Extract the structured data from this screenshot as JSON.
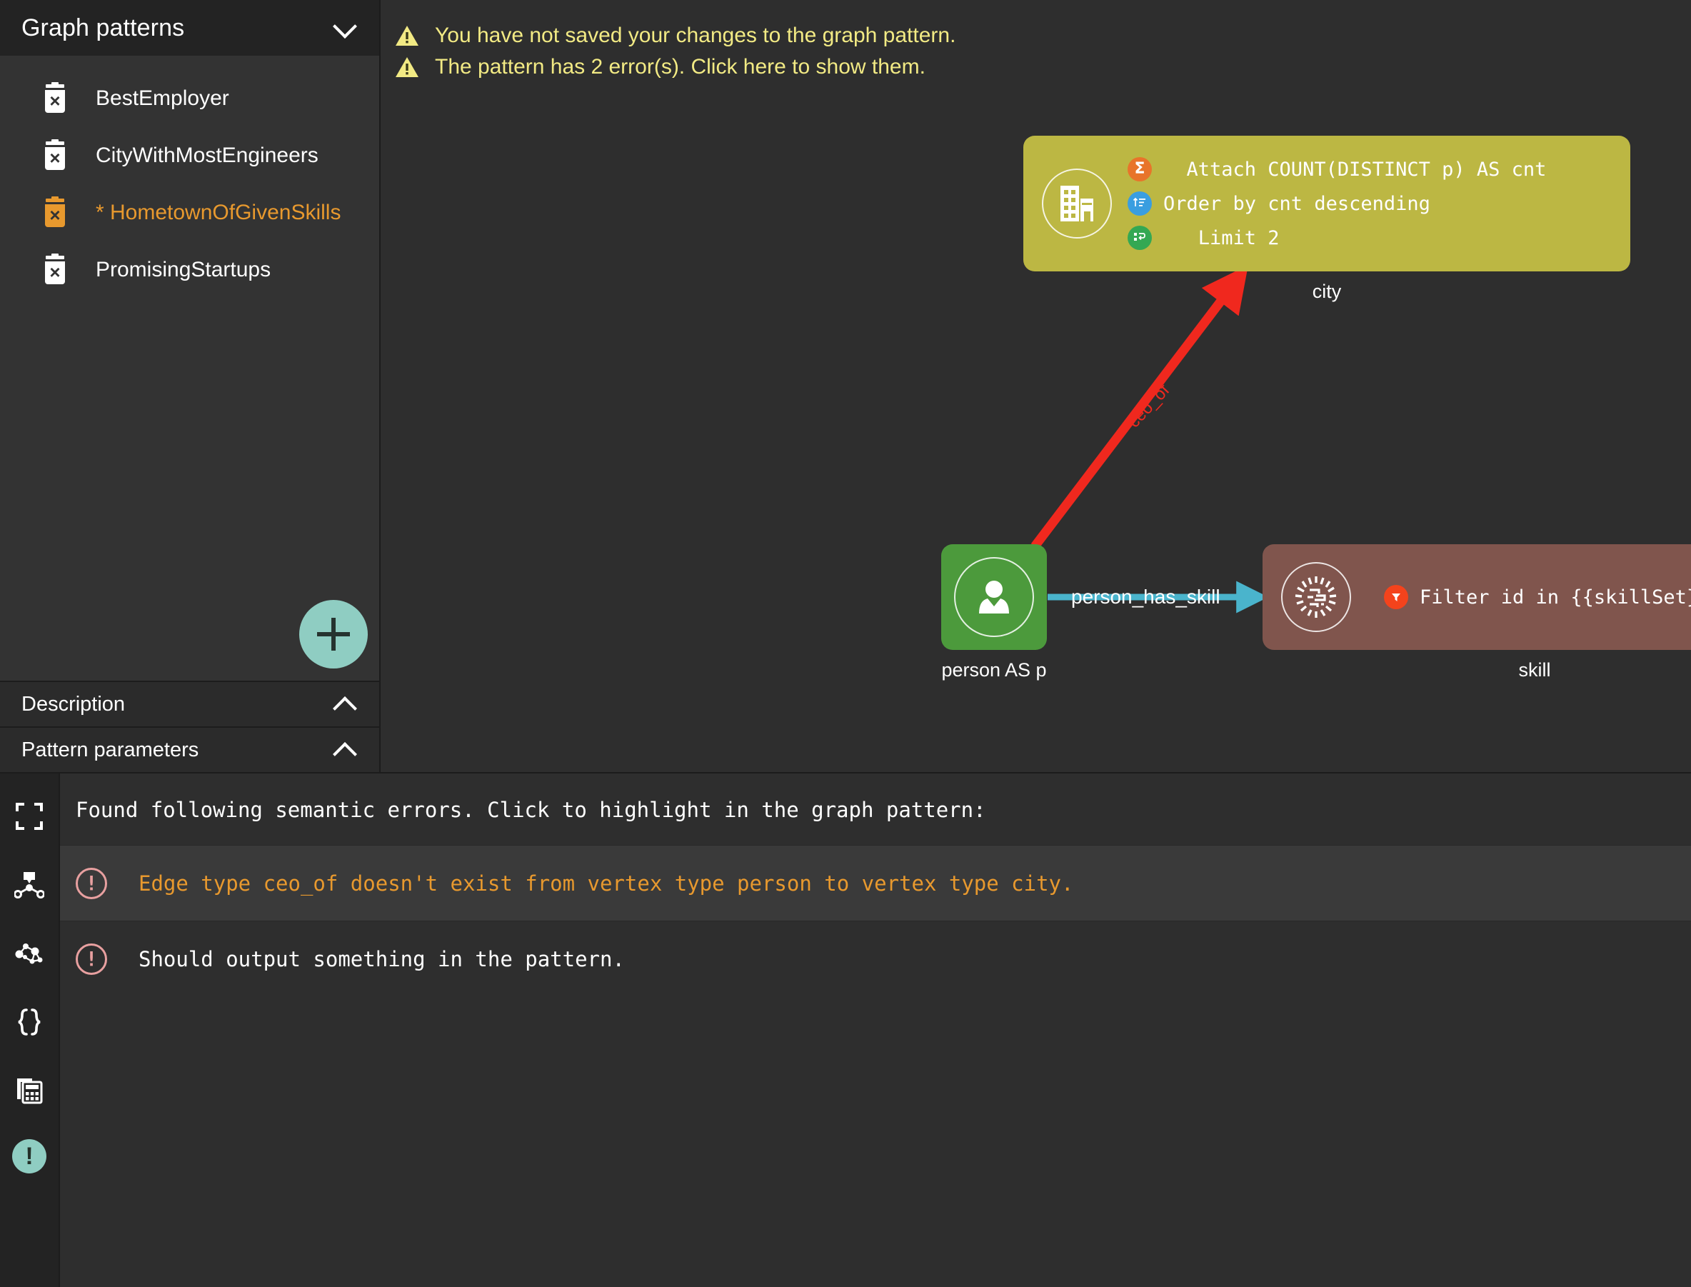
{
  "sidebar": {
    "header_title": "Graph patterns",
    "collapse_icon": "chevron-down-icon",
    "patterns": [
      {
        "label": "BestEmployer",
        "active": false,
        "delete_icon": "trash-delete-icon"
      },
      {
        "label": "CityWithMostEngineers",
        "active": false,
        "delete_icon": "trash-delete-icon"
      },
      {
        "label": "* HometownOfGivenSkills",
        "active": true,
        "delete_icon": "trash-delete-icon"
      },
      {
        "label": "PromisingStartups",
        "active": false,
        "delete_icon": "trash-delete-icon"
      }
    ],
    "add_button_icon": "plus-icon",
    "sections": [
      {
        "label": "Description",
        "icon": "chevron-up-icon"
      },
      {
        "label": "Pattern parameters",
        "icon": "chevron-up-icon"
      }
    ],
    "active_color": "#e8992e"
  },
  "canvas": {
    "warnings": [
      {
        "icon": "warning-triangle-icon",
        "text": "You have not saved your changes to the graph pattern."
      },
      {
        "icon": "warning-triangle-icon",
        "text": "The pattern has 2 error(s). Click here to show them."
      }
    ],
    "warning_color": "#f2ea84",
    "nodes": [
      {
        "id": "city",
        "label": "city",
        "icon": "building-city-icon",
        "color": "#bcb743",
        "statements": [
          {
            "badge": "sum-aggregate-icon",
            "badge_symbol": "Σ",
            "text": "  Attach COUNT(DISTINCT p) AS cnt"
          },
          {
            "badge": "order-by-icon",
            "badge_symbol": "",
            "text": "Order by cnt descending"
          },
          {
            "badge": "limit-icon",
            "badge_symbol": "",
            "text": "   Limit 2"
          }
        ]
      },
      {
        "id": "person",
        "label": "person AS p",
        "icon": "person-avatar-icon",
        "color": "#4c9a3c",
        "statements": []
      },
      {
        "id": "skill",
        "label": "skill",
        "icon": "chip-skill-icon",
        "color": "#80554d",
        "statements": [
          {
            "badge": "filter-funnel-icon",
            "badge_symbol": "",
            "text": "Filter id in {{skillSet}}"
          }
        ]
      }
    ],
    "edges": [
      {
        "id": "ceo_of",
        "label": "ceo_of",
        "from": "person",
        "to": "city",
        "color": "#f0281e",
        "state": "error"
      },
      {
        "id": "person_has_skill",
        "label": "person_has_skill",
        "from": "person",
        "to": "skill",
        "color": "#4ab4cc",
        "state": "ok"
      }
    ]
  },
  "bottom_panel": {
    "rail_icons": [
      {
        "name": "expand-fullscreen-icon",
        "active": false
      },
      {
        "name": "graph-pattern-icon",
        "active": false
      },
      {
        "name": "network-graph-icon",
        "active": false
      },
      {
        "name": "json-braces-icon",
        "active": false
      },
      {
        "name": "table-results-icon",
        "active": false
      },
      {
        "name": "error-alert-icon",
        "symbol": "!",
        "active": true
      }
    ],
    "header": "Found following semantic errors. Click to highlight in the graph pattern:",
    "errors": [
      {
        "icon": "error-circle-icon",
        "text": "Edge type ceo_of doesn't exist from vertex type person to vertex type city.",
        "highlighted": true
      },
      {
        "icon": "error-circle-icon",
        "text": "Should output something in the pattern.",
        "highlighted": false
      }
    ],
    "error_color": "#e8992e",
    "accent_color": "#8fcdc2"
  }
}
